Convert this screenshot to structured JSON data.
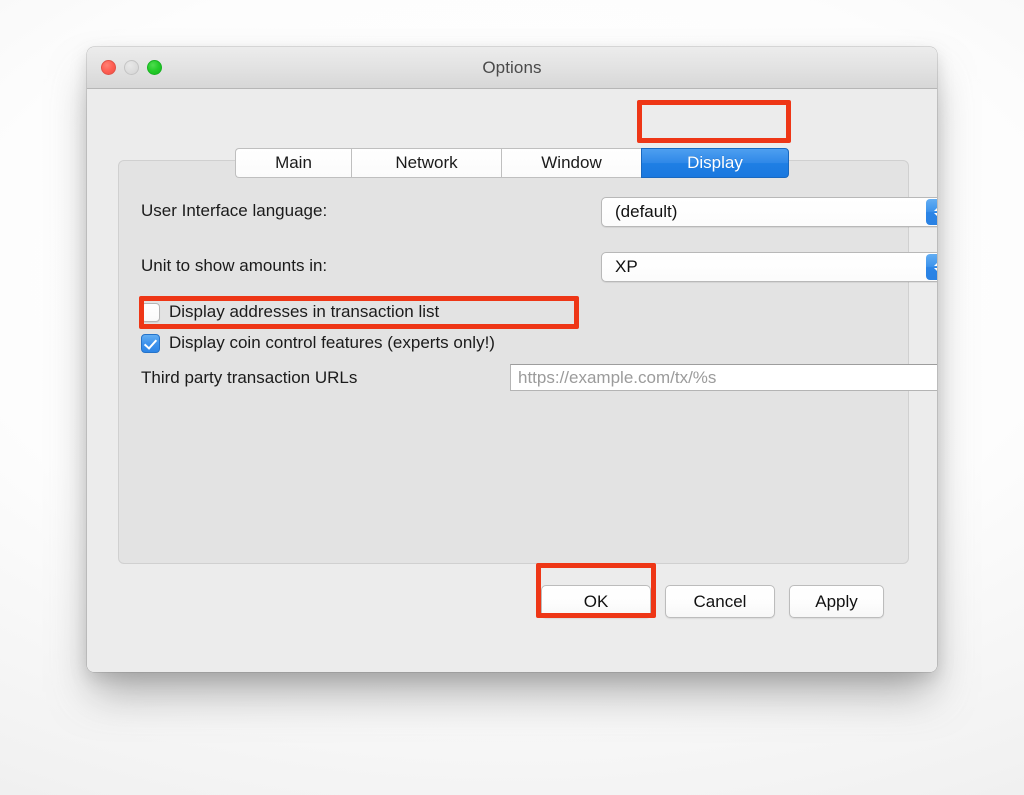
{
  "window": {
    "title": "Options",
    "traffic_lights": [
      {
        "name": "close-button",
        "color": "#ff6055"
      },
      {
        "name": "minimize-button",
        "color": "#dedede"
      },
      {
        "name": "zoom-button",
        "color": "#25cc2a"
      }
    ]
  },
  "tabs": [
    {
      "label": "Main",
      "selected": false
    },
    {
      "label": "Network",
      "selected": false
    },
    {
      "label": "Window",
      "selected": false
    },
    {
      "label": "Display",
      "selected": true
    }
  ],
  "form": {
    "language_row": {
      "label": "User Interface language:",
      "value": "(default)"
    },
    "unit_row": {
      "label": "Unit to show amounts in:",
      "value": "XP"
    },
    "checkbox_addresses": {
      "label": "Display addresses in transaction list",
      "checked": false
    },
    "checkbox_coincontrol": {
      "label": "Display coin control features (experts only!)",
      "checked": true
    },
    "url_row": {
      "label": "Third party transaction URLs",
      "value": "",
      "placeholder": "https://example.com/tx/%s"
    }
  },
  "buttons": {
    "ok": "OK",
    "cancel": "Cancel",
    "apply": "Apply"
  },
  "annotations": {
    "color": "#ee3616",
    "targets": [
      "display-tab",
      "coin-control-checkbox",
      "ok-button"
    ]
  }
}
